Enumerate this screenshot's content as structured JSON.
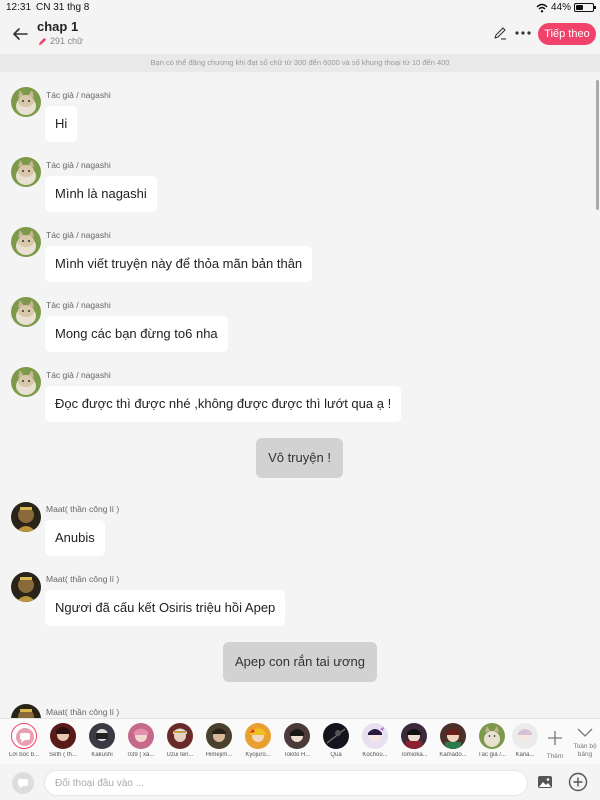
{
  "status_bar": {
    "time": "12:31",
    "date": "CN 31 thg 8",
    "battery": "44%",
    "battery_level": 0.44
  },
  "header": {
    "title": "chap 1",
    "word_count": "291 chữ",
    "next_label": "Tiếp theo",
    "accent_color": "#f0426b"
  },
  "notice": "Bạn có thể đăng chương khi đạt số chữ từ 300 đến 6000 và số khung thoại từ 10 đến 400",
  "messages": [
    {
      "author": "Tác giả / nagashi",
      "text": "Hi"
    },
    {
      "author": "Tác giả / nagashi",
      "text": "Mình là nagashi"
    },
    {
      "author": "Tác giả / nagashi",
      "text": "Mình viết truyện này để thỏa mãn bản thân"
    },
    {
      "author": "Tác giả / nagashi",
      "text": "Mong các bạn đừng to6 nha"
    },
    {
      "author": "Tác giả / nagashi",
      "text": "Đọc được thì được nhé ,không được được thì lướt qua ạ !"
    },
    {
      "narration": "Vô truyện !"
    },
    {
      "author": "Maat( thần công lí )",
      "text": "Anubis"
    },
    {
      "author": "Maat( thần công lí )",
      "text": "Ngươi đã cấu kết Osiris triệu hồi Apep"
    },
    {
      "narration": "Apep con rắn tai ương"
    },
    {
      "author": "Maat( thần công lí )",
      "text": ""
    }
  ],
  "characters": [
    {
      "name": "Lời bốc b..."
    },
    {
      "name": "Seth ( th..."
    },
    {
      "name": "Kakushi"
    },
    {
      "name": "039 ( xá..."
    },
    {
      "name": "Uzui ten..."
    },
    {
      "name": "Himejim..."
    },
    {
      "name": "Kyojuro..."
    },
    {
      "name": "Tokito H..."
    },
    {
      "name": "Qua"
    },
    {
      "name": "Kochou..."
    },
    {
      "name": "Tomioka..."
    },
    {
      "name": "Kamado..."
    },
    {
      "name": "Tác giả /..."
    },
    {
      "name": "Kana..."
    }
  ],
  "add_label": "Thêm",
  "collapse_label": "Toàn bộ bảng",
  "input": {
    "placeholder": "Đối thoại đầu vào ..."
  }
}
